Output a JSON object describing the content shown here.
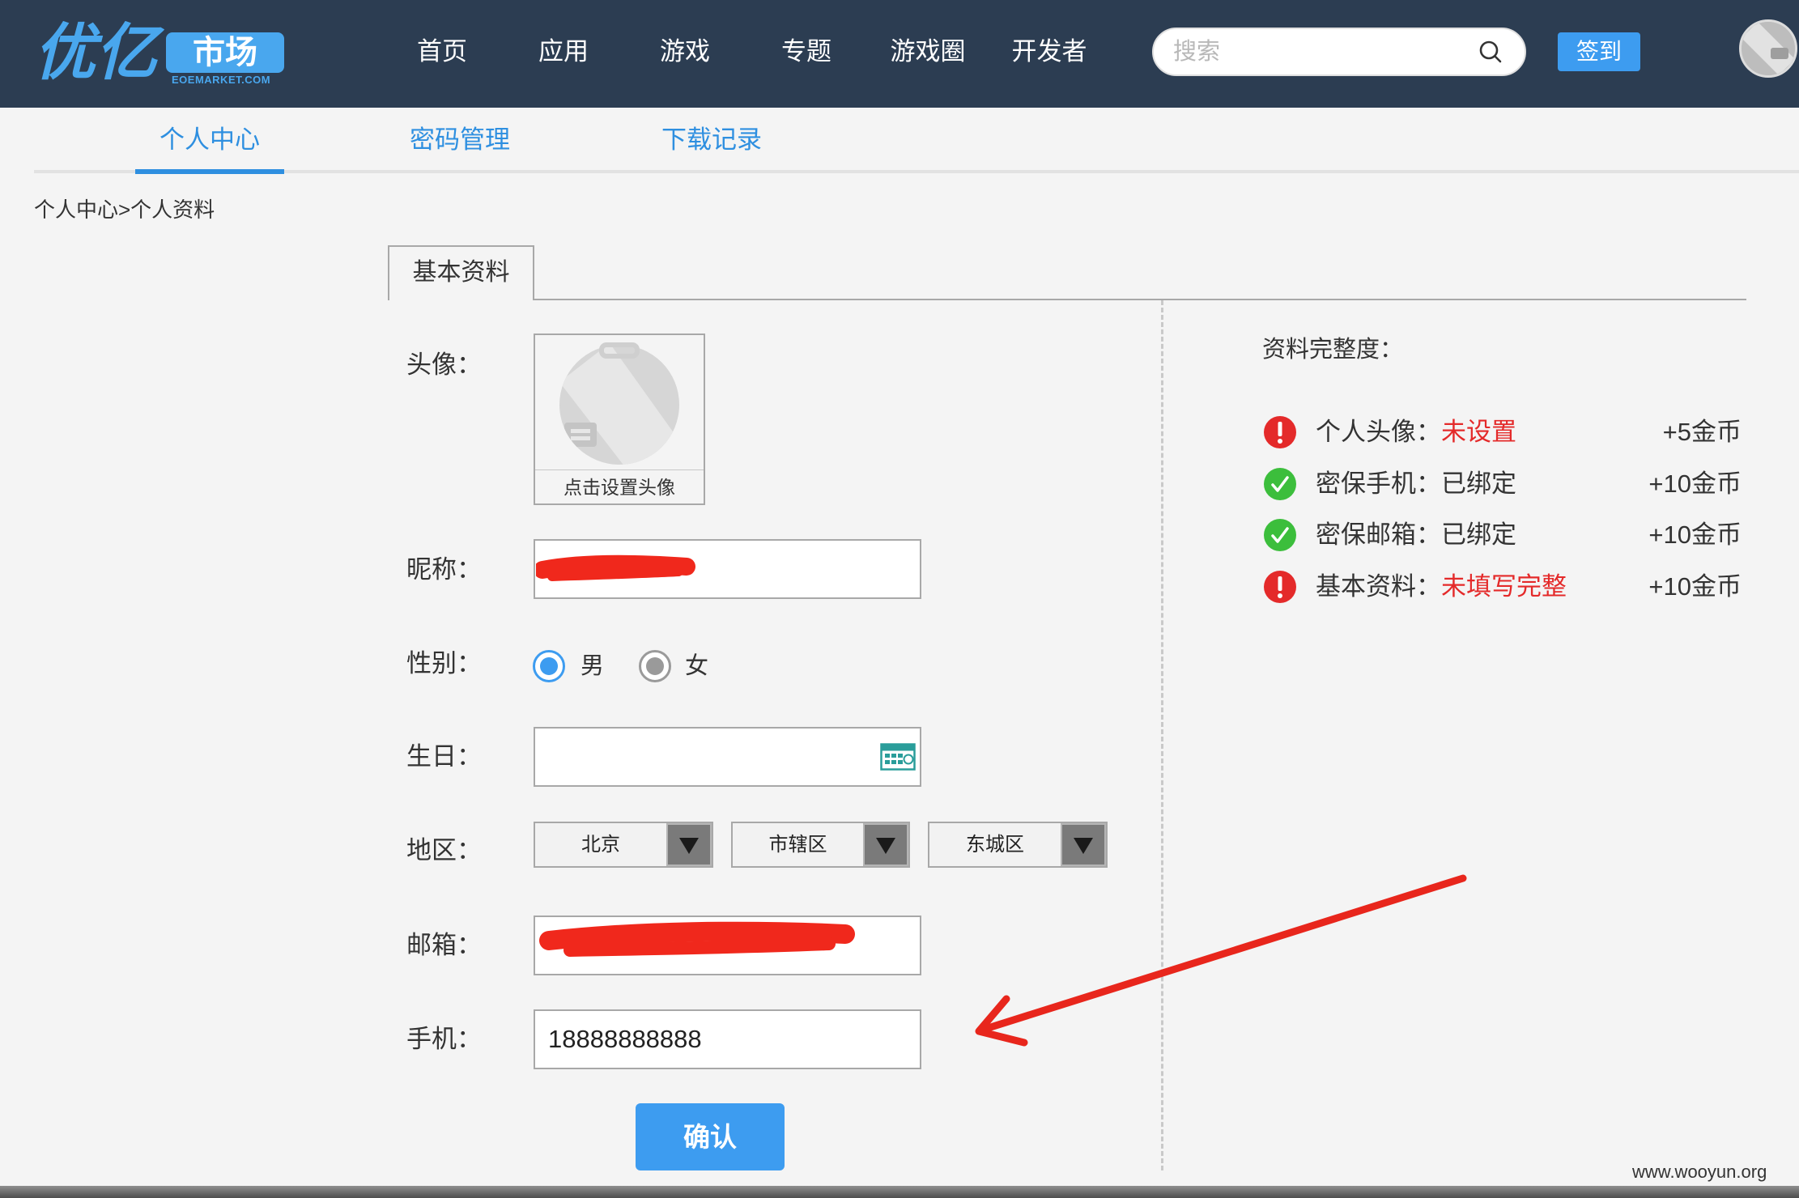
{
  "header": {
    "logo_primary": "优亿",
    "logo_box": "市场",
    "logo_sub": "EOEMARKET.COM",
    "nav": [
      "首页",
      "应用",
      "游戏",
      "专题",
      "游戏圈",
      "开发者"
    ],
    "search": {
      "placeholder": "搜索",
      "icon": "search-icon"
    },
    "checkin_label": "签到",
    "avatar_icon": "user-avatar-icon"
  },
  "tabs": [
    {
      "label": "个人中心",
      "active": true
    },
    {
      "label": "密码管理",
      "active": false
    },
    {
      "label": "下载记录",
      "active": false
    }
  ],
  "breadcrumb": "个人中心>个人资料",
  "panel_tab": "基本资料",
  "form": {
    "avatar": {
      "label": "头像：",
      "caption": "点击设置头像",
      "icon": "default-avatar-icon"
    },
    "nickname": {
      "label": "昵称："
    },
    "gender": {
      "label": "性别：",
      "options": [
        {
          "label": "男",
          "selected": true
        },
        {
          "label": "女",
          "selected": false
        }
      ]
    },
    "birthday": {
      "label": "生日：",
      "value": "",
      "icon": "calendar-icon"
    },
    "region": {
      "label": "地区：",
      "province": "北京",
      "city": "市辖区",
      "district": "东城区",
      "icon": "chevron-down-icon"
    },
    "email": {
      "label": "邮箱："
    },
    "phone": {
      "label": "手机：",
      "value": "18888888888"
    },
    "submit_label": "确认"
  },
  "completeness": {
    "title": "资料完整度：",
    "items": [
      {
        "label": "个人头像：",
        "status": "未设置",
        "state": "missing",
        "icon": "error-icon",
        "reward": "+5金币"
      },
      {
        "label": "密保手机：",
        "status": "已绑定",
        "state": "done",
        "icon": "check-icon",
        "reward": "+10金币"
      },
      {
        "label": "密保邮箱：",
        "status": "已绑定",
        "state": "done",
        "icon": "check-icon",
        "reward": "+10金币"
      },
      {
        "label": "基本资料：",
        "status": "未填写完整",
        "state": "missing",
        "icon": "error-icon",
        "reward": "+10金币"
      }
    ]
  },
  "watermark": "www.wooyun.org",
  "colors": {
    "header_bg": "#2c3d52",
    "accent": "#3d9cf0",
    "tab_text": "#2e8fe0",
    "error": "#e42a2a",
    "success": "#3cbe3c",
    "page_bg": "#f4f4f4",
    "annotation": "#e8261c"
  }
}
